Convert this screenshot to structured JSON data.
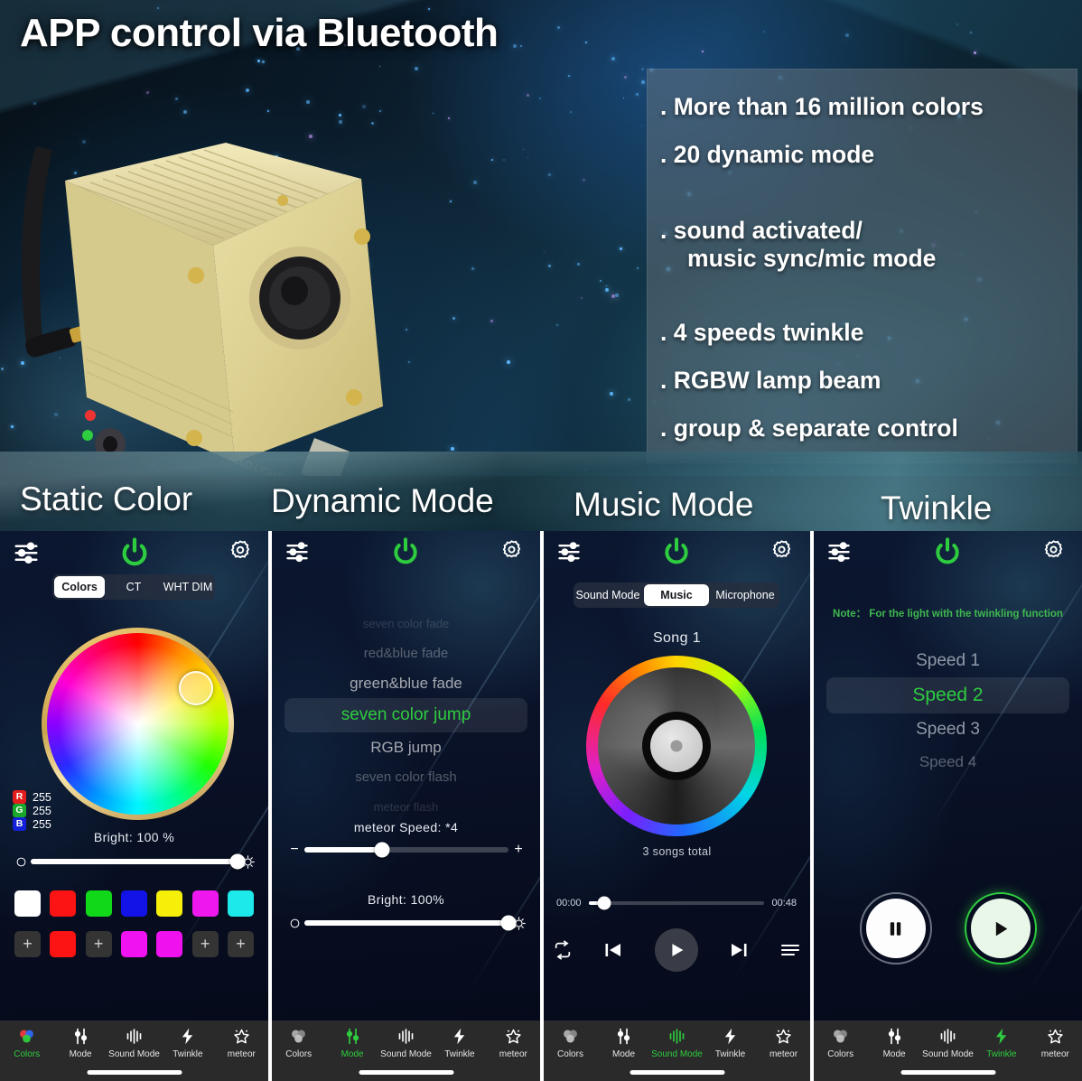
{
  "hero": {
    "title": "APP control via Bluetooth",
    "product_label": "LED LIGHT ENGINE",
    "features": [
      ". More than 16 million colors",
      ". 20 dynamic mode",
      ". sound activated/",
      "music sync/mic mode",
      ". 4 speeds twinkle",
      ". RGBW lamp beam",
      ". group & separate control"
    ]
  },
  "sections": [
    {
      "label": "Static Color"
    },
    {
      "label": "Dynamic Mode"
    },
    {
      "label": "Music Mode"
    },
    {
      "label": "Twinkle"
    }
  ],
  "colors": {
    "accent_green": "#2ecc3f",
    "nav_bg": "#2a2a2a",
    "screen_bg": "#0a1228"
  },
  "nav": {
    "items": [
      {
        "label": "Colors",
        "icon": "colors-circles-icon"
      },
      {
        "label": "Mode",
        "icon": "sliders-icon"
      },
      {
        "label": "Sound Mode",
        "icon": "equalizer-icon"
      },
      {
        "label": "Twinkle",
        "icon": "lightning-icon"
      },
      {
        "label": "meteor",
        "icon": "star-icon"
      }
    ]
  },
  "topbar": {
    "left_icon": "equalizer-settings-icon",
    "power_icon": "power-icon",
    "right_icon": "gear-icon"
  },
  "screen_static": {
    "tabs": [
      {
        "label": "Colors",
        "active": true
      },
      {
        "label": "CT",
        "active": false
      },
      {
        "label": "WHT DIM",
        "active": false
      }
    ],
    "rgb": [
      {
        "chip": "R",
        "value": "255",
        "chip_color": "#e41c1c"
      },
      {
        "chip": "G",
        "value": "255",
        "chip_color": "#19a82c"
      },
      {
        "chip": "B",
        "value": "255",
        "chip_color": "#1322d8"
      }
    ],
    "bright_label": "Bright:  100 %",
    "bright_percent": 100,
    "swatches_row1": [
      "#ffffff",
      "#fc1313",
      "#12d81a",
      "#1313e8",
      "#f5ef0a",
      "#ee18ee",
      "#1ee9ea"
    ],
    "swatches_row2": [
      "plus",
      "#fc1313",
      "plus",
      "#f112f1",
      "#ef12ef",
      "plus",
      "plus"
    ],
    "plus_label": "+",
    "active_nav": "Colors"
  },
  "screen_dynamic": {
    "modes": [
      {
        "label": "seven color fade",
        "state": "faded3"
      },
      {
        "label": "red&blue fade",
        "state": "faded2"
      },
      {
        "label": "green&blue fade",
        "state": "faded1"
      },
      {
        "label": "seven color jump",
        "state": "active"
      },
      {
        "label": "RGB jump",
        "state": "faded1"
      },
      {
        "label": "seven color flash",
        "state": "faded2"
      },
      {
        "label": "meteor flash",
        "state": "faded3"
      }
    ],
    "speed_label": "meteor Speed:  *4",
    "speed_percent": 38,
    "speed_minus": "−",
    "speed_plus": "+",
    "bright_label": "Bright:  100%",
    "bright_percent": 100,
    "active_nav": "Mode"
  },
  "screen_music": {
    "tabs": [
      {
        "label": "Sound Mode",
        "active": false
      },
      {
        "label": "Music",
        "active": true
      },
      {
        "label": "Microphone",
        "active": false
      }
    ],
    "song_title": "Song 1",
    "songs_total": "3 songs total",
    "time_start": "00:00",
    "time_end": "00:48",
    "progress_percent": 9,
    "controls": [
      {
        "icon": "repeat-icon",
        "name": "repeat-button"
      },
      {
        "icon": "previous-icon",
        "name": "previous-button"
      },
      {
        "icon": "play-icon",
        "name": "play-button"
      },
      {
        "icon": "next-icon",
        "name": "next-button"
      },
      {
        "icon": "playlist-icon",
        "name": "playlist-button"
      }
    ],
    "active_nav": "Sound Mode"
  },
  "screen_twinkle": {
    "note": "Note： For the light with the twinkling function",
    "speeds": [
      {
        "label": "Speed 1",
        "state": "dim1"
      },
      {
        "label": "Speed 2",
        "state": "active"
      },
      {
        "label": "Speed 3",
        "state": "dim1"
      },
      {
        "label": "Speed 4",
        "state": "dim2"
      }
    ],
    "pause_button": "pause-icon",
    "play_button": "play-icon",
    "active_nav": "Twinkle"
  }
}
